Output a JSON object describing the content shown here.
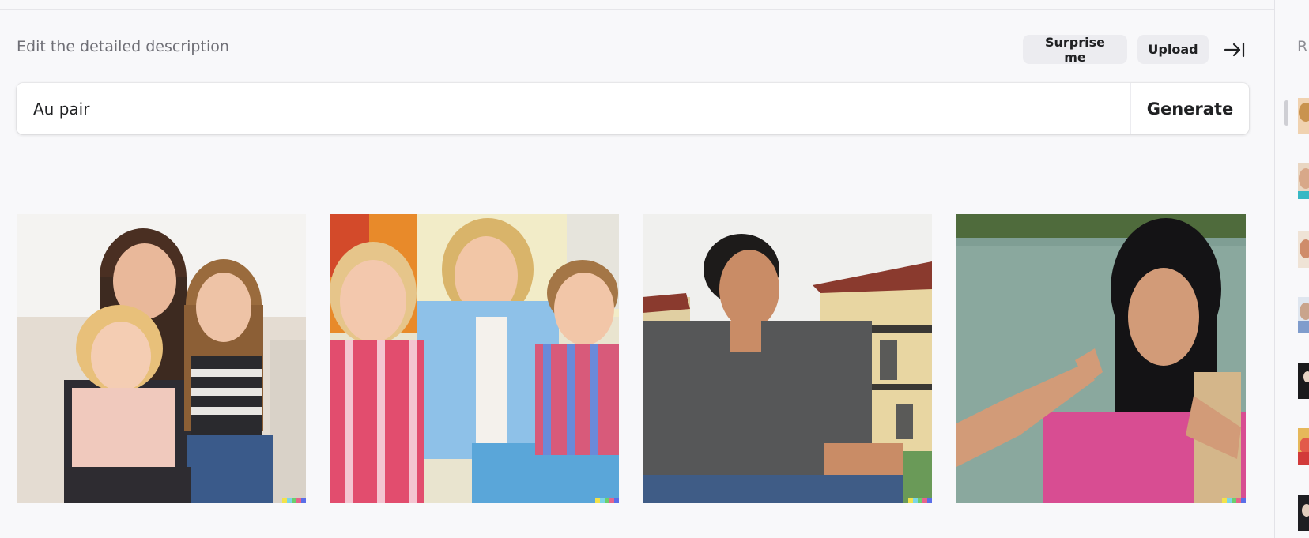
{
  "header": {
    "title": "Edit the detailed description",
    "surprise_label": "Surprise me",
    "upload_label": "Upload",
    "collapse_icon": "arrow-right-to-bar-icon"
  },
  "prompt": {
    "value": "Au pair",
    "generate_label": "Generate"
  },
  "results": {
    "images": [
      {
        "name": "au-pair-woman-with-two-girls"
      },
      {
        "name": "au-pair-woman-with-girl-and-boy"
      },
      {
        "name": "au-pair-man-smiling-outdoors"
      },
      {
        "name": "au-pair-woman-pointing-by-water"
      }
    ],
    "signature_colors": [
      "#f2e24a",
      "#7ad6e6",
      "#6ccf6c",
      "#e6648a",
      "#5b6ee8"
    ]
  },
  "sidebar": {
    "label": "R",
    "thumbnail_count": 7
  },
  "colors": {
    "background": "#f8f8fa",
    "pill": "#ececf0",
    "text": "#202123",
    "muted": "#6f6f76"
  }
}
